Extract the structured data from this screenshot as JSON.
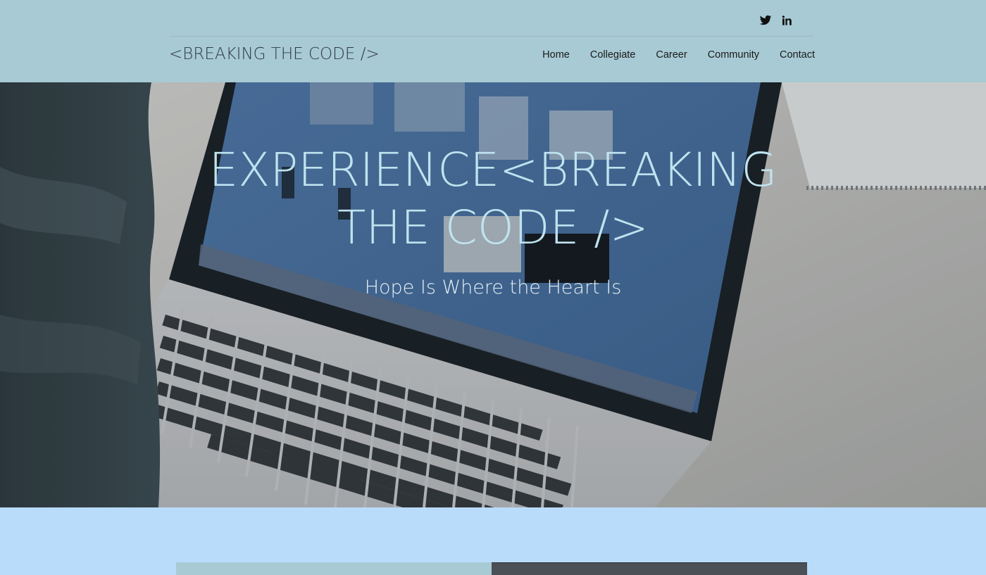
{
  "site": {
    "logo": "<BREAKING THE CODE />"
  },
  "social": [
    {
      "name": "twitter-icon"
    },
    {
      "name": "linkedin-icon"
    }
  ],
  "nav": {
    "items": [
      "Home",
      "Collegiate",
      "Career",
      "Community",
      "Contact"
    ]
  },
  "hero": {
    "title_line1": "EXPERIENCE<BREAKING",
    "title_line2": "THE CODE />",
    "subtitle": "Hope Is Where the Heart Is"
  },
  "colors": {
    "header_bg": "#a8cad4",
    "band_bg": "#b9dcfb",
    "hero_text": "#bfe3ef"
  }
}
